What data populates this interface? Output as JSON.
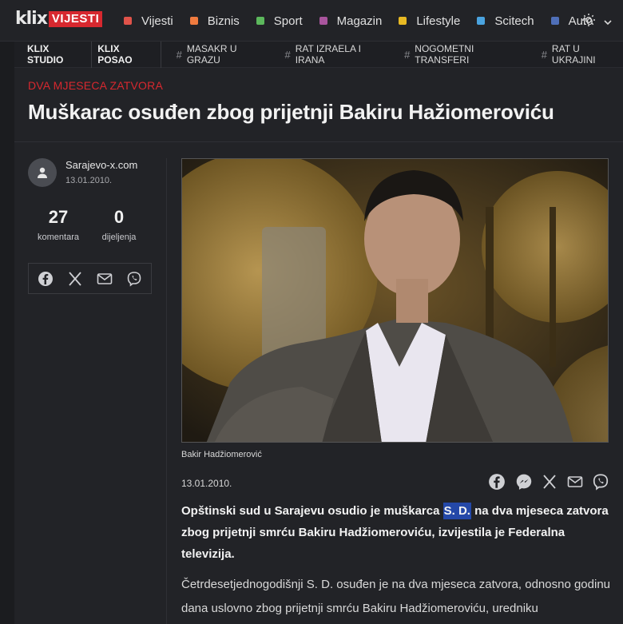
{
  "brand": {
    "logo_text": "klix",
    "logo_section": "VIJESTI"
  },
  "nav": {
    "items": [
      {
        "label": "Vijesti",
        "color": "#e0534a"
      },
      {
        "label": "Biznis",
        "color": "#f07b3f"
      },
      {
        "label": "Sport",
        "color": "#5cb85c"
      },
      {
        "label": "Magazin",
        "color": "#a9559d"
      },
      {
        "label": "Lifestyle",
        "color": "#e8b923"
      },
      {
        "label": "Scitech",
        "color": "#4aa3df"
      },
      {
        "label": "Auto",
        "color": "#4f6fb8"
      }
    ],
    "theme_icon": "sun-icon"
  },
  "secondary": {
    "pills": [
      "KLIX STUDIO",
      "KLIX POSAO"
    ],
    "tags": [
      "MASAKR U GRAZU",
      "RAT IZRAELA I IRANA",
      "NOGOMETNI TRANSFERI",
      "RAT U UKRAJINI"
    ]
  },
  "article": {
    "kicker": "DVA MJESECA ZATVORA",
    "title": "Muškarac osuđen zbog prijetnji Bakiru Hažiomeroviću",
    "source": "Sarajevo-x.com",
    "date": "13.01.2010.",
    "comments_count": "27",
    "comments_label": "komentara",
    "shares_count": "0",
    "shares_label": "dijeljenja",
    "image_caption": "Bakir Hadžiomerović",
    "published": "13.01.2010.",
    "lead_before": "Opštinski sud u Sarajevu osudio je muškarca ",
    "lead_highlight": "S. D.",
    "lead_after": " na dva mjeseca zatvora zbog prijetnji smrću Bakiru Hadžiomeroviću, izvijestila je Federalna televizija.",
    "body": "Četrdesetjednogodišnji S. D. osuđen je na dva mjeseca zatvora, odnosno godinu dana uslovno zbog prijetnji smrću Bakiru Hadžiomeroviću, uredniku"
  },
  "colors": {
    "accent": "#d7282f",
    "highlight": "#2448a8",
    "background": "#1b1c1f",
    "panel": "#222327"
  }
}
